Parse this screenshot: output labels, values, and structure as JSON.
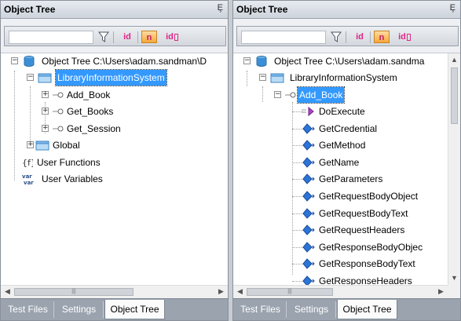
{
  "left": {
    "title": "Object Tree",
    "pin": "Ȩ",
    "search_value": "",
    "toolbar": {
      "id_label": "id",
      "n_label": "n",
      "idb_label": "id"
    },
    "tree": [
      {
        "text": "Object Tree C:\\Users\\adam.sandman\\D",
        "icon": "database-icon"
      },
      {
        "text": "LibraryInformationSystem",
        "icon": "folder-icon",
        "selected": true
      },
      {
        "text": "Add_Book",
        "icon": "object-key-icon"
      },
      {
        "text": "Get_Books",
        "icon": "object-key-icon"
      },
      {
        "text": "Get_Session",
        "icon": "object-key-icon"
      },
      {
        "text": "Global",
        "icon": "folder-icon"
      },
      {
        "text": "User Functions",
        "icon": "function-icon"
      },
      {
        "text": "User Variables",
        "icon": "variable-icon"
      }
    ],
    "tabs": [
      "Test Files",
      "Settings",
      "Object Tree"
    ]
  },
  "right": {
    "title": "Object Tree",
    "pin": "Ȩ",
    "search_value": "",
    "toolbar": {
      "id_label": "id",
      "n_label": "n",
      "idb_label": "id"
    },
    "tree": [
      {
        "text": "Object Tree C:\\Users\\adam.sandma",
        "icon": "database-icon"
      },
      {
        "text": "LibraryInformationSystem",
        "icon": "folder-icon"
      },
      {
        "text": "Add_Book",
        "icon": "object-key-icon",
        "selected": true
      },
      {
        "text": "DoExecute",
        "icon": "action-icon"
      },
      {
        "text": "GetCredential",
        "icon": "method-icon"
      },
      {
        "text": "GetMethod",
        "icon": "method-icon"
      },
      {
        "text": "GetName",
        "icon": "method-icon"
      },
      {
        "text": "GetParameters",
        "icon": "method-icon"
      },
      {
        "text": "GetRequestBodyObject",
        "icon": "method-icon"
      },
      {
        "text": "GetRequestBodyText",
        "icon": "method-icon"
      },
      {
        "text": "GetRequestHeaders",
        "icon": "method-icon"
      },
      {
        "text": "GetResponseBodyObjec",
        "icon": "method-icon"
      },
      {
        "text": "GetResponseBodyText",
        "icon": "method-icon"
      },
      {
        "text": "GetResponseHeaders",
        "icon": "method-icon"
      }
    ],
    "tabs": [
      "Test Files",
      "Settings",
      "Object Tree"
    ]
  },
  "colors": {
    "selection": "#3399ff",
    "accent_pink": "#e02585",
    "tab_bar": "#9aa3ae"
  }
}
